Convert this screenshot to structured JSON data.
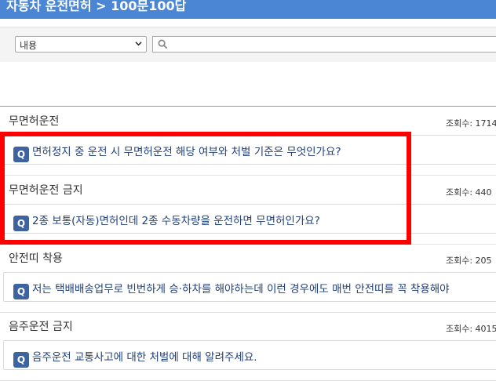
{
  "header": {
    "breadcrumb": "자동차 운전면허 > 100문100답"
  },
  "toolbar": {
    "select_value": "내용",
    "search_placeholder": ""
  },
  "items": [
    {
      "category": "무면허운전",
      "views": "조회수: 1714",
      "question": "면허정지 중 운전 시 무면허운전 해당 여부와 처벌 기준은 무엇인가요?"
    },
    {
      "category": "무면허운전 금지",
      "views": "조회수: 440",
      "question": "2종 보통(자동)면허인데 2종 수동차량을 운전하면 무면허인가요?"
    },
    {
      "category": "안전띠 착용",
      "views": "조회수: 205",
      "question": "저는 택배배송업무로 빈번하게 승·하차를 해야하는데 이런 경우에도 매번 안전띠를 꼭 착용해야"
    },
    {
      "category": "음주운전 금지",
      "views": "조회수: 4015",
      "question": "음주운전 교통사고에 대한 처벌에 대해 알려주세요."
    }
  ],
  "badge_label": "Q",
  "icons": {
    "select": "chevron-down-icon",
    "search": "search-icon"
  },
  "colors": {
    "header": "#4a86d4",
    "badge": "#3d64a0",
    "highlight": "#ff0000",
    "link": "#1f3f7a"
  }
}
